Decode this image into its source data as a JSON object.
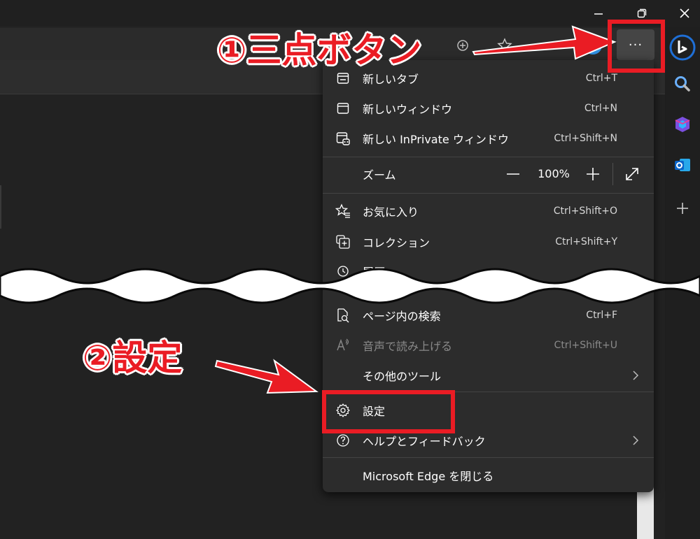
{
  "menu": {
    "items": [
      {
        "label": "新しいタブ",
        "shortcut": "Ctrl+T"
      },
      {
        "label": "新しいウィンドウ",
        "shortcut": "Ctrl+N"
      },
      {
        "label": "新しい InPrivate ウィンドウ",
        "shortcut": "Ctrl+Shift+N"
      },
      {
        "label": "ズーム",
        "zoom_value": "100%"
      },
      {
        "label": "お気に入り",
        "shortcut": "Ctrl+Shift+O"
      },
      {
        "label": "コレクション",
        "shortcut": "Ctrl+Shift+Y"
      },
      {
        "label": "履歴",
        "shortcut": ""
      },
      {
        "label": "ページ内の検索",
        "shortcut": "Ctrl+F"
      },
      {
        "label": "音声で読み上げる",
        "shortcut": "Ctrl+Shift+U",
        "disabled": true
      },
      {
        "label": "その他のツール",
        "submenu": true
      },
      {
        "label": "設定",
        "shortcut": ""
      },
      {
        "label": "ヘルプとフィードバック",
        "submenu": true
      },
      {
        "label": "Microsoft Edge を閉じる",
        "shortcut": ""
      }
    ]
  },
  "toolbar": {
    "more_button_label": "···"
  },
  "annotations": {
    "step1": "①三点ボタン",
    "step2": "②設定",
    "accent_color": "#ea1c24"
  },
  "sidebar_icons": [
    "bing-copilot-icon",
    "search-icon",
    "microsoft365-icon",
    "outlook-icon",
    "add-icon"
  ],
  "window_controls": [
    "minimize-icon",
    "restore-icon",
    "close-icon"
  ]
}
